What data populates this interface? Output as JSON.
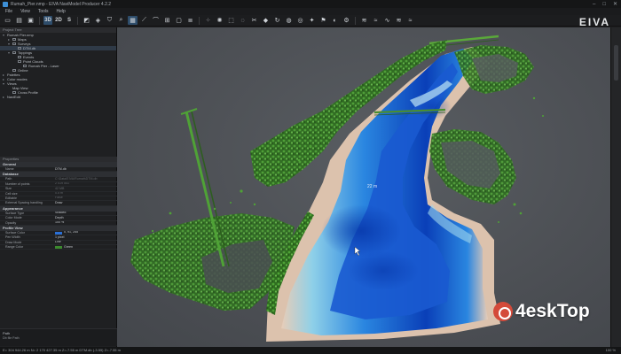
{
  "window": {
    "title": "Rumah_Pier.nmp - EIVA NaviModel Producer 4.2.2",
    "controls": [
      "–",
      "□",
      "✕"
    ]
  },
  "menu": [
    "File",
    "View",
    "Tools",
    "Help"
  ],
  "toolbar": {
    "view_modes": [
      "3D",
      "2D",
      "S"
    ],
    "brand": "EIVA"
  },
  "tree": {
    "header": "Project Tree",
    "items": [
      {
        "label": "Rumah Pier.nmp",
        "level": 0,
        "arrow": "▾",
        "check": false
      },
      {
        "label": "Maps",
        "level": 1,
        "arrow": "▸",
        "check": true
      },
      {
        "label": "Surveys",
        "level": 1,
        "arrow": "▾",
        "check": true
      },
      {
        "label": "DTM.db",
        "level": 2,
        "arrow": "",
        "check": true,
        "selected": true
      },
      {
        "label": "Toppings",
        "level": 1,
        "arrow": "▾",
        "check": true
      },
      {
        "label": "Events",
        "level": 2,
        "arrow": "",
        "check": true
      },
      {
        "label": "Point Clouds",
        "level": 2,
        "arrow": "",
        "check": true
      },
      {
        "label": "Rumah Pier - Laser",
        "level": 3,
        "arrow": "",
        "check": true
      },
      {
        "label": "Online",
        "level": 1,
        "arrow": "",
        "check": true
      },
      {
        "label": "Palettes",
        "level": 0,
        "arrow": "▸",
        "check": false
      },
      {
        "label": "Color modes",
        "level": 0,
        "arrow": "▸",
        "check": false
      },
      {
        "label": "Views",
        "level": 0,
        "arrow": "▾",
        "check": false
      },
      {
        "label": "Map View",
        "level": 1,
        "arrow": "",
        "check": false
      },
      {
        "label": "Cross Profile",
        "level": 1,
        "arrow": "",
        "check": true
      },
      {
        "label": "NaviEdit",
        "level": 0,
        "arrow": "▸",
        "check": false
      }
    ]
  },
  "properties": {
    "header": "Properties",
    "sections": [
      {
        "title": "General",
        "rows": [
          {
            "key": "Name",
            "value": "DTM.db",
            "dim": false
          }
        ]
      },
      {
        "title": "Database",
        "rows": [
          {
            "key": "Path",
            "value": "C:\\Data\\EIVA\\Rumah\\DTM.db",
            "dim": true
          },
          {
            "key": "Number of points",
            "value": "2 019 541",
            "dim": true
          },
          {
            "key": "Size",
            "value": "42 MB",
            "dim": true
          },
          {
            "key": "Cell size",
            "value": "0.5 m",
            "dim": true
          },
          {
            "key": "Editable",
            "value": "False",
            "dim": true
          },
          {
            "key": "External Spacing handling",
            "value": "Draw",
            "dim": false
          }
        ]
      },
      {
        "title": "Appearance",
        "rows": [
          {
            "key": "Surface Type",
            "value": "Shaded",
            "dim": false
          },
          {
            "key": "Color Mode",
            "value": "Depth",
            "dim": false
          },
          {
            "key": "Opacity",
            "value": "100 %",
            "dim": false
          }
        ]
      },
      {
        "title": "Profile View",
        "rows": [
          {
            "key": "Surface Color",
            "value": "0, 91, 255",
            "dim": false,
            "swatch": "#2a6fd6"
          },
          {
            "key": "Pen Width",
            "value": "1 pixel",
            "dim": false
          },
          {
            "key": "Draw Mode",
            "value": "Line",
            "dim": false
          },
          {
            "key": "Range Color",
            "value": "Green",
            "dim": false,
            "swatch": "#3c8a2e"
          }
        ]
      }
    ],
    "description_title": "Path",
    "description_text": "Db file Path"
  },
  "viewport": {
    "cursor_label": "22 m"
  },
  "colors": {
    "deep_water": "#0a3fb8",
    "mid_water": "#2a86e0",
    "shallow": "#8fd0e8",
    "sand": "#e8cdb8",
    "vegetation": "#3f8f2a",
    "background": "#4f5257"
  },
  "status": {
    "text": "E= 304 944.26 m  N= 2 170 427.35 m  Z=-7.55 m  DTM.db  (-3.55)  Z=-7.55 m",
    "zoom": "100 %"
  },
  "watermark": {
    "text": "4eskTop"
  }
}
